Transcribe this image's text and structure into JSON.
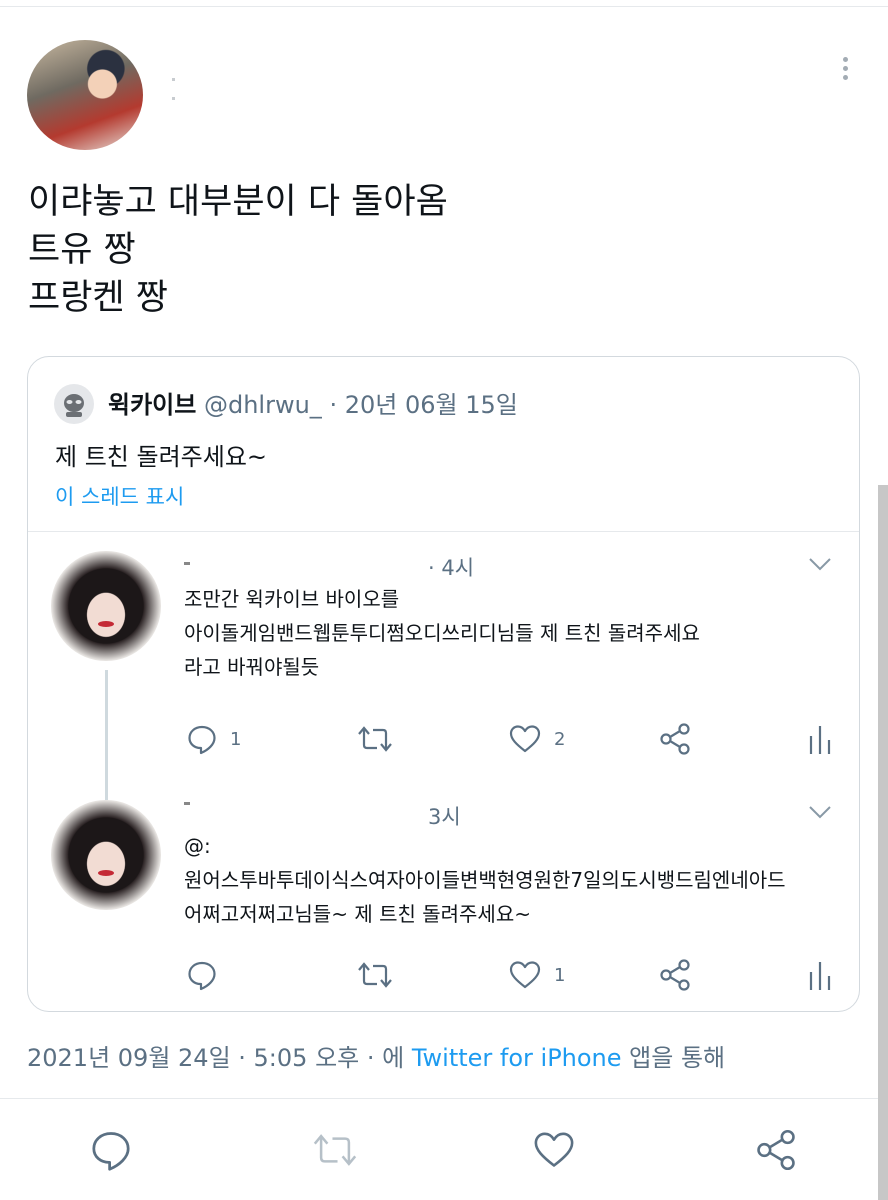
{
  "tweet": {
    "lines": [
      "이랴놓고 대부분이 다 돌아옴",
      "트유 짱",
      "프랑켄 짱"
    ],
    "timestamp": "2021년 09월 24일 · 5:05 오후 · 에 ",
    "source": "Twitter for iPhone",
    "source_suffix": " 앱을 통해"
  },
  "quote": {
    "name": "윅카이브",
    "handle": "@dhlrwu_",
    "date": "· 20년 06월 15일",
    "text": "제 트친 돌려주세요~",
    "thread_link": "이 스레드 표시"
  },
  "replies": [
    {
      "time": "· 4시",
      "lines": [
        "조만간 윅카이브 바이오를",
        "아이돌게임밴드웹툰투디쩜오디쓰리디님들 제 트친 돌려주세요",
        "라고 바꿔야될듯"
      ],
      "reply_count": "1",
      "like_count": "2"
    },
    {
      "time": "3시",
      "lines": [
        "@:",
        "원어스투바투데이식스여자아이들변백현영원한7일의도시뱅드림엔네아드",
        "어쩌고저쩌고님들~ 제 트친 돌려주세요~"
      ],
      "reply_count": "",
      "like_count": "1"
    }
  ],
  "icons": [
    "more-vertical-icon",
    "reply-icon",
    "retweet-icon",
    "like-icon",
    "share-icon",
    "analytics-icon",
    "chevron-down-icon"
  ],
  "colors": {
    "link": "#1d9bf0",
    "muted": "#5b7083",
    "text": "#0f1419",
    "border": "#d3d9de"
  }
}
